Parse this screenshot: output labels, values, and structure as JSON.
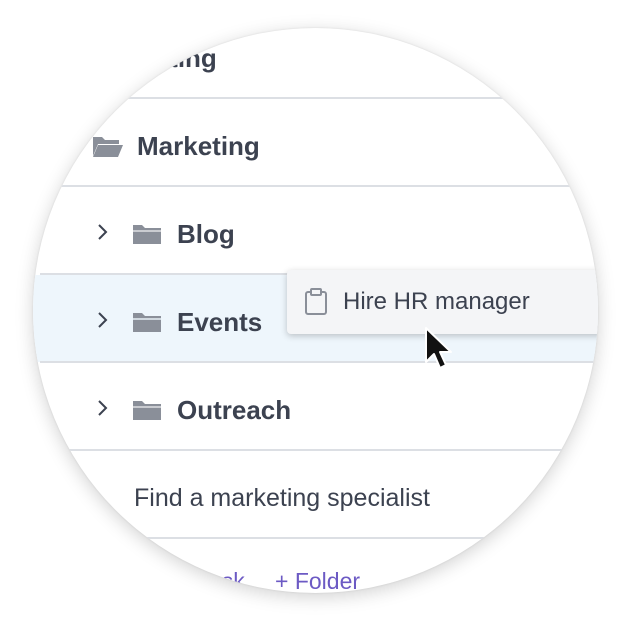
{
  "tree": {
    "items": [
      {
        "label": "Marketing",
        "icon": "folder-open-icon",
        "partial": true
      },
      {
        "label": "Marketing",
        "icon": "folder-open-icon"
      },
      {
        "label": "Blog",
        "icon": "folder-icon",
        "expander": "chevron-right-icon"
      },
      {
        "label": "Events",
        "icon": "folder-icon",
        "expander": "chevron-right-icon",
        "highlighted": true
      },
      {
        "label": "Outreach",
        "icon": "folder-icon",
        "expander": "chevron-right-icon"
      }
    ],
    "task": {
      "label": "Find a marketing specialist"
    }
  },
  "actions": {
    "add_task_label": "+ Task",
    "add_folder_label": "+ Folder"
  },
  "drag_preview": {
    "label": "Hire HR manager",
    "icon": "clipboard-icon"
  },
  "colors": {
    "text": "#3c4250",
    "icon": "#8a8f99",
    "divider": "#dcdfe4",
    "highlight": "#eef6fc",
    "link": "#6c5ac4"
  }
}
